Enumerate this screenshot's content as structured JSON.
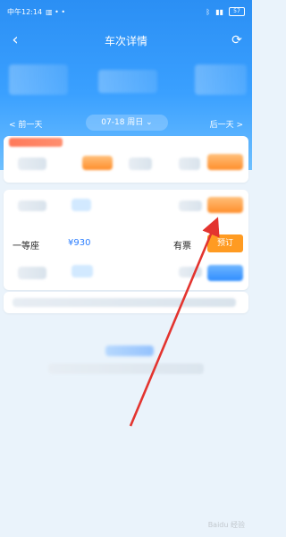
{
  "status_bar": {
    "time": "中午12:14",
    "battery": "57"
  },
  "header": {
    "title": "车次详情"
  },
  "date_nav": {
    "prev_label": "< 前一天",
    "date_label": "07-18 周日 ⌄",
    "next_label": "后一天 >"
  },
  "seat": {
    "name": "一等座",
    "price": "¥930",
    "availability": "有票",
    "book_label": "预订"
  },
  "watermark": "Baidu 经验",
  "colors": {
    "primary_blue": "#2b8ff4",
    "book_orange": "#ff9b22"
  }
}
